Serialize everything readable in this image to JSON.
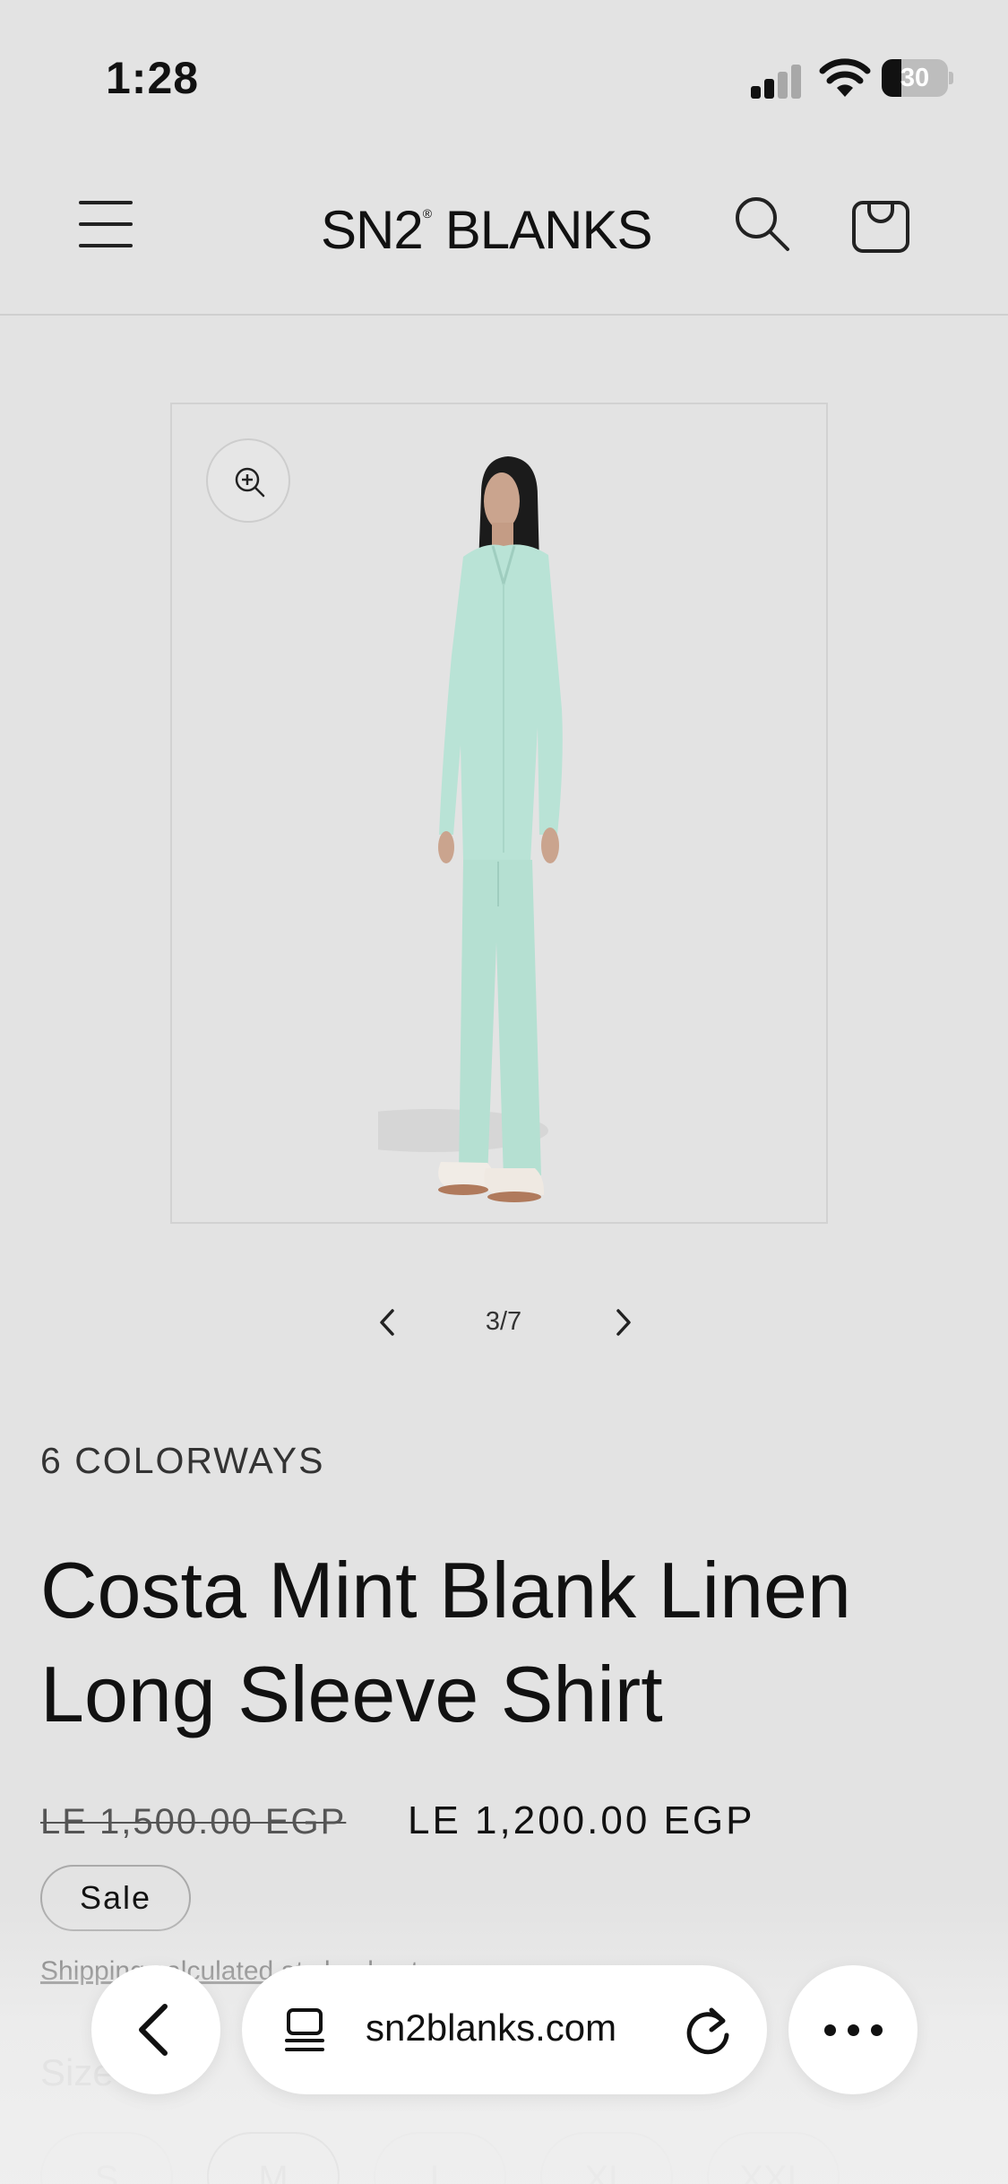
{
  "status_bar": {
    "time": "1:28",
    "battery_percent": "30",
    "battery_level": 0.3
  },
  "header": {
    "logo_text": "SN2",
    "logo_mark": "®",
    "logo_text_2": "BLANKS",
    "icons": [
      "menu-icon",
      "search-icon",
      "cart-icon"
    ]
  },
  "gallery": {
    "counter": "3/7",
    "icons": [
      "zoom-in-icon",
      "chevron-left-icon",
      "chevron-right-icon"
    ]
  },
  "product": {
    "colorways": "6 COLORWAYS",
    "title": "Costa Mint Blank Linen Long Sleeve Shirt",
    "price_compare": "LE 1,500.00 EGP",
    "price_sale": "LE 1,200.00 EGP",
    "sale_badge": "Sale",
    "shipping_note": "Shipping calculated at checkout.",
    "size_label": "Size",
    "sizes": [
      "S",
      "M",
      "L",
      "XL",
      "XXL"
    ],
    "selected_size": "M",
    "garment_color": "#b9e3d6"
  },
  "browser": {
    "url": "sn2blanks.com",
    "icons": [
      "back-icon",
      "tabs-icon",
      "reload-icon",
      "more-icon"
    ]
  },
  "colors": {
    "background": "#e3e3e3",
    "text": "#111111"
  }
}
